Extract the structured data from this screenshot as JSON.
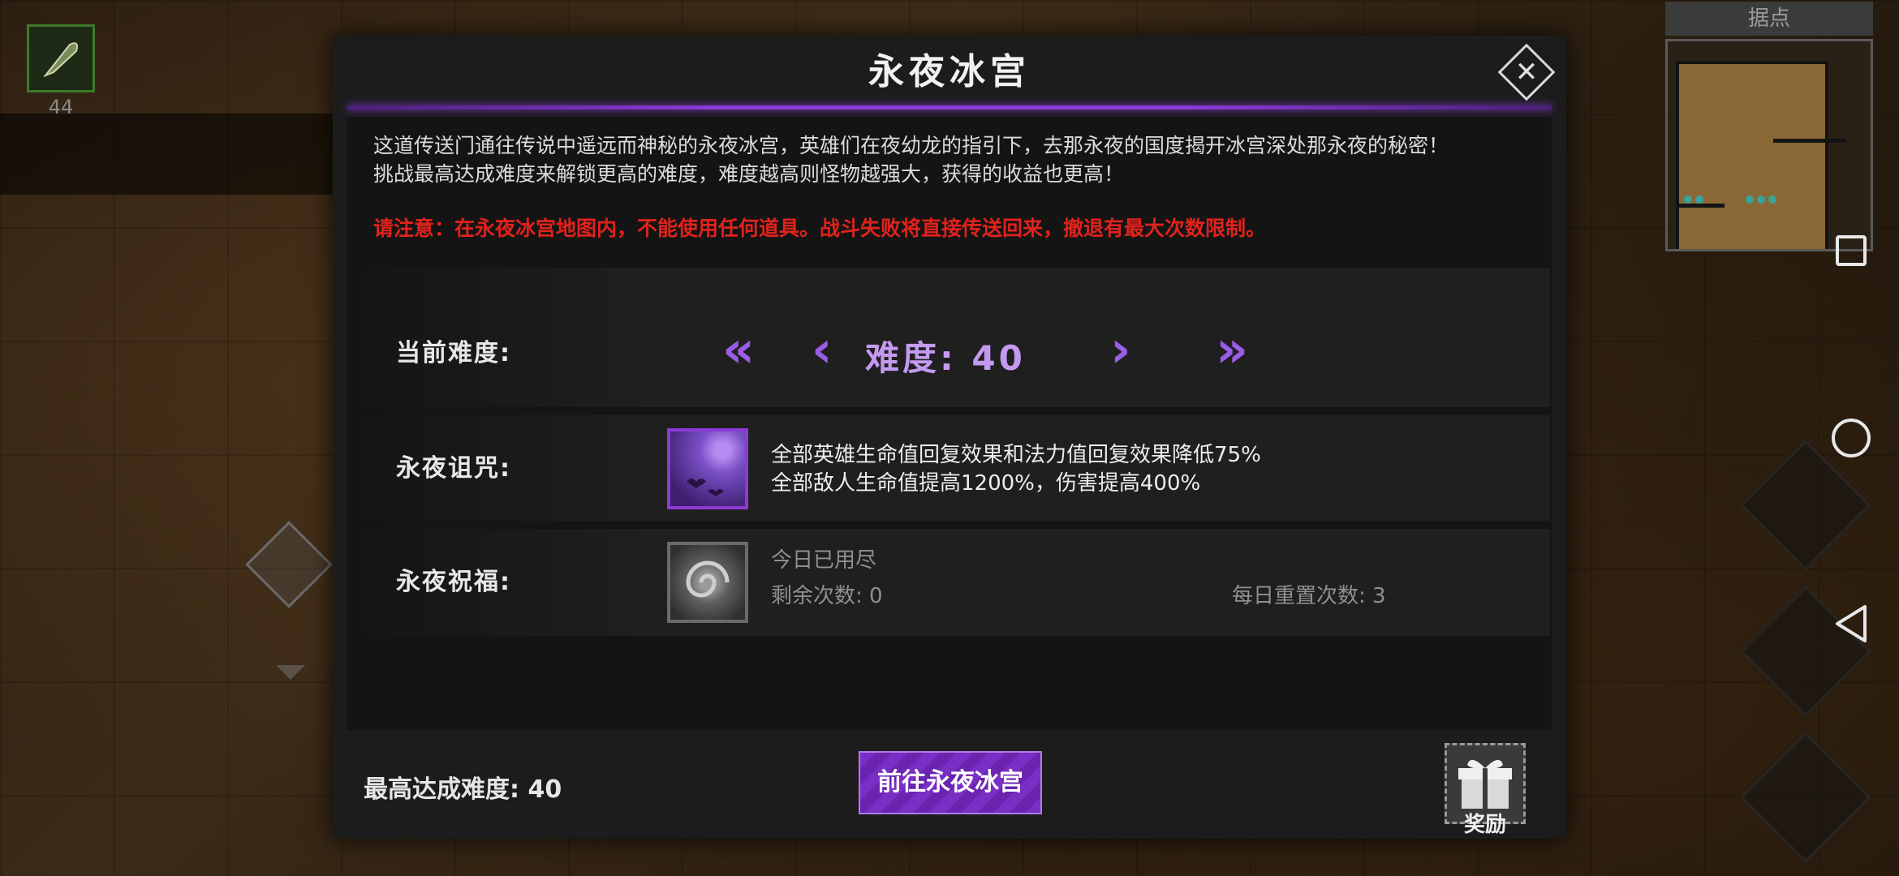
{
  "hud": {
    "item_count": "44",
    "minimap_title": "据点"
  },
  "dialog": {
    "title": "永夜冰宫",
    "description_line1": "这道传送门通往传说中遥远而神秘的永夜冰宫，英雄们在夜幼龙的指引下，去那永夜的国度揭开冰宫深处那永夜的秘密！",
    "description_line2": "挑战最高达成难度来解锁更高的难度，难度越高则怪物越强大，获得的收益也更高！",
    "warning": "请注意：在永夜冰宫地图内，不能使用任何道具。战斗失败将直接传送回来，撤退有最大次数限制。",
    "difficulty": {
      "label": "当前难度:",
      "display": "难度: 40",
      "value": 40,
      "first_symbol": "«",
      "prev_symbol": "‹",
      "next_symbol": "›",
      "last_symbol": "»"
    },
    "curse": {
      "label": "永夜诅咒:",
      "line1": "全部英雄生命值回复效果和法力值回复效果降低75%",
      "line2": "全部敌人生命值提高1200%，伤害提高400%",
      "icon": "bat-moon-icon"
    },
    "blessing": {
      "label": "永夜祝福:",
      "status": "今日已用尽",
      "remaining": "剩余次数: 0",
      "daily_reset": "每日重置次数: 3",
      "icon": "swirl-icon"
    },
    "best_difficulty": "最高达成难度: 40",
    "go_button": "前往永夜冰宫",
    "reward_label": "奖励",
    "close_symbol": "✕"
  },
  "colors": {
    "accent_purple": "#8a3ad6",
    "warning_red": "#e0221c"
  }
}
